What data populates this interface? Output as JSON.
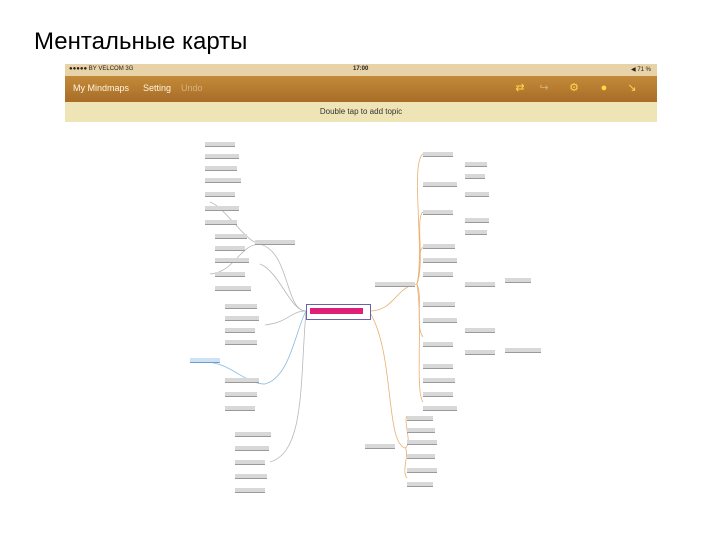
{
  "slide": {
    "title": "Ментальные карты"
  },
  "status_bar": {
    "carrier": "●●●●● BY VELCOM  3G",
    "time": "17:00",
    "battery": "◀ 71 %"
  },
  "toolbar": {
    "my_mindmaps": "My Mindmaps",
    "setting": "Setting",
    "third": "Undo",
    "icons": [
      "share-icon",
      "gear-icon",
      "info-icon",
      "expand-icon"
    ]
  },
  "hint": "Double tap to add topic",
  "colors": {
    "toolbar": "#b67a30",
    "hint_bar": "#efe4b6",
    "central_topic": "#e01f7b",
    "branch_orange": "#e8b070",
    "branch_blue": "#8ab8e0",
    "branch_gray": "#b8b8b8"
  }
}
